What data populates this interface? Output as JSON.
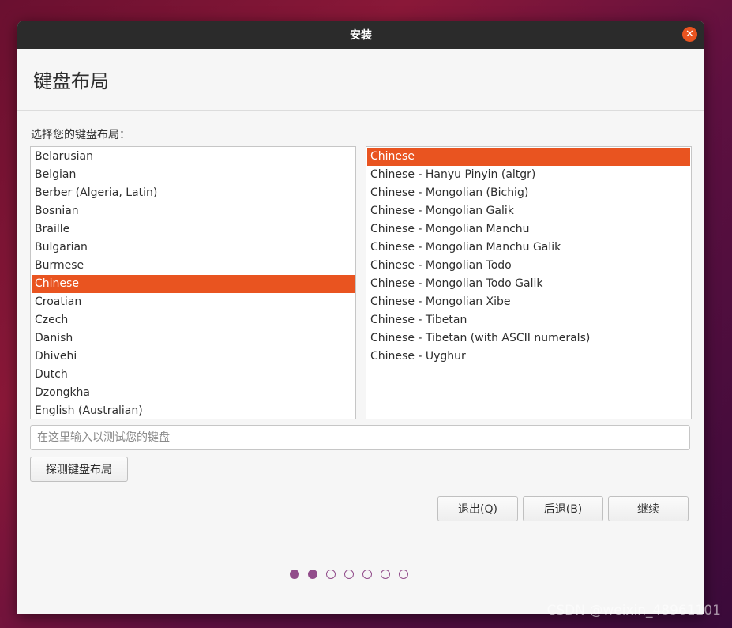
{
  "window": {
    "title": "安装"
  },
  "header": {
    "title": "键盘布局"
  },
  "prompt": "选择您的键盘布局：",
  "layouts": {
    "items": [
      "Belarusian",
      "Belgian",
      "Berber (Algeria, Latin)",
      "Bosnian",
      "Braille",
      "Bulgarian",
      "Burmese",
      "Chinese",
      "Croatian",
      "Czech",
      "Danish",
      "Dhivehi",
      "Dutch",
      "Dzongkha",
      "English (Australian)"
    ],
    "selected": "Chinese"
  },
  "variants": {
    "items": [
      "Chinese",
      "Chinese - Hanyu Pinyin (altgr)",
      "Chinese - Mongolian (Bichig)",
      "Chinese - Mongolian Galik",
      "Chinese - Mongolian Manchu",
      "Chinese - Mongolian Manchu Galik",
      "Chinese - Mongolian Todo",
      "Chinese - Mongolian Todo Galik",
      "Chinese - Mongolian Xibe",
      "Chinese - Tibetan",
      "Chinese - Tibetan (with ASCII numerals)",
      "Chinese - Uyghur"
    ],
    "selected": "Chinese"
  },
  "test_input": {
    "placeholder": "在这里输入以测试您的键盘",
    "value": ""
  },
  "buttons": {
    "detect": "探测键盘布局",
    "quit": "退出(Q)",
    "back": "后退(B)",
    "continue": "继续"
  },
  "progress": {
    "total": 7,
    "current": 2
  },
  "watermark": "CSDN @weixin_48961101",
  "colors": {
    "accent": "#e95420",
    "progress": "#924d8b",
    "titlebar": "#2b2b2b"
  },
  "icons": {
    "close": "close-icon"
  }
}
